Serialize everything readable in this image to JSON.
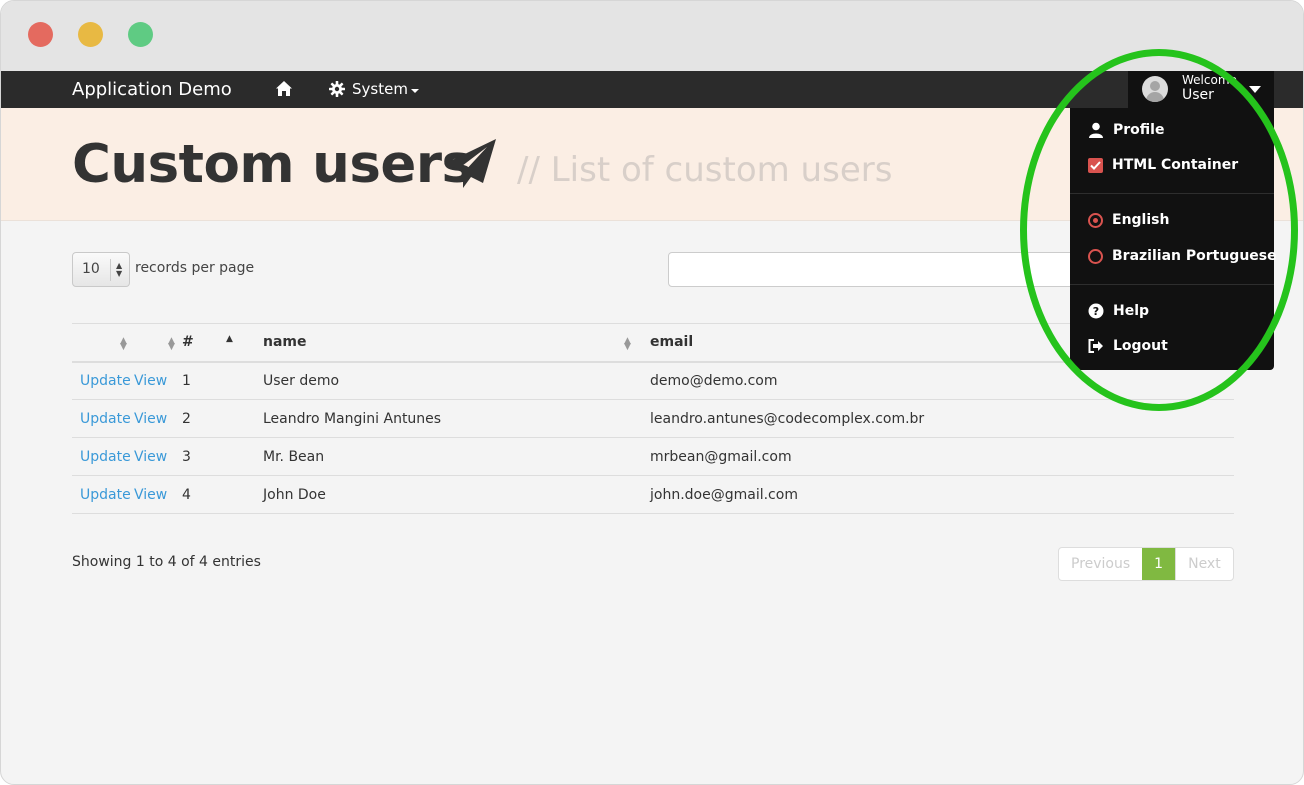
{
  "window": {
    "controls": [
      "close",
      "minimize",
      "maximize"
    ]
  },
  "navbar": {
    "brand": "Application Demo",
    "home_icon": "home-icon",
    "system_label": "System",
    "system_icon": "gear-icon",
    "user": {
      "welcome": "Welcome",
      "name": "User"
    }
  },
  "header": {
    "title": "Custom users",
    "title_icon": "paper-plane-icon",
    "subtitle": "// List of custom users"
  },
  "table_controls": {
    "length_value": "10",
    "length_label": "records per page",
    "search_placeholder": ""
  },
  "table": {
    "columns": [
      "",
      "",
      "#",
      "name",
      "email"
    ],
    "rows": [
      {
        "update": "Update",
        "view": "View",
        "id": "1",
        "name": "User demo",
        "email": "demo@demo.com"
      },
      {
        "update": "Update",
        "view": "View",
        "id": "2",
        "name": "Leandro Mangini Antunes",
        "email": "leandro.antunes@codecomplex.com.br"
      },
      {
        "update": "Update",
        "view": "View",
        "id": "3",
        "name": "Mr. Bean",
        "email": "mrbean@gmail.com"
      },
      {
        "update": "Update",
        "view": "View",
        "id": "4",
        "name": "John Doe",
        "email": "john.doe@gmail.com"
      }
    ]
  },
  "footer": {
    "info": "Showing 1 to 4 of 4 entries",
    "pagination": {
      "previous": "Previous",
      "current": "1",
      "next": "Next"
    }
  },
  "user_dropdown": {
    "profile": "Profile",
    "html_container": "HTML Container",
    "english": "English",
    "portuguese": "Brazilian Portuguese",
    "help": "Help",
    "logout": "Logout"
  },
  "colors": {
    "navbar": "#2b2b2b",
    "header_bg": "#fbeee4",
    "link": "#3a99d8",
    "accent_red": "#d9534f",
    "pager_active": "#80b941",
    "highlight": "#25c31c"
  }
}
